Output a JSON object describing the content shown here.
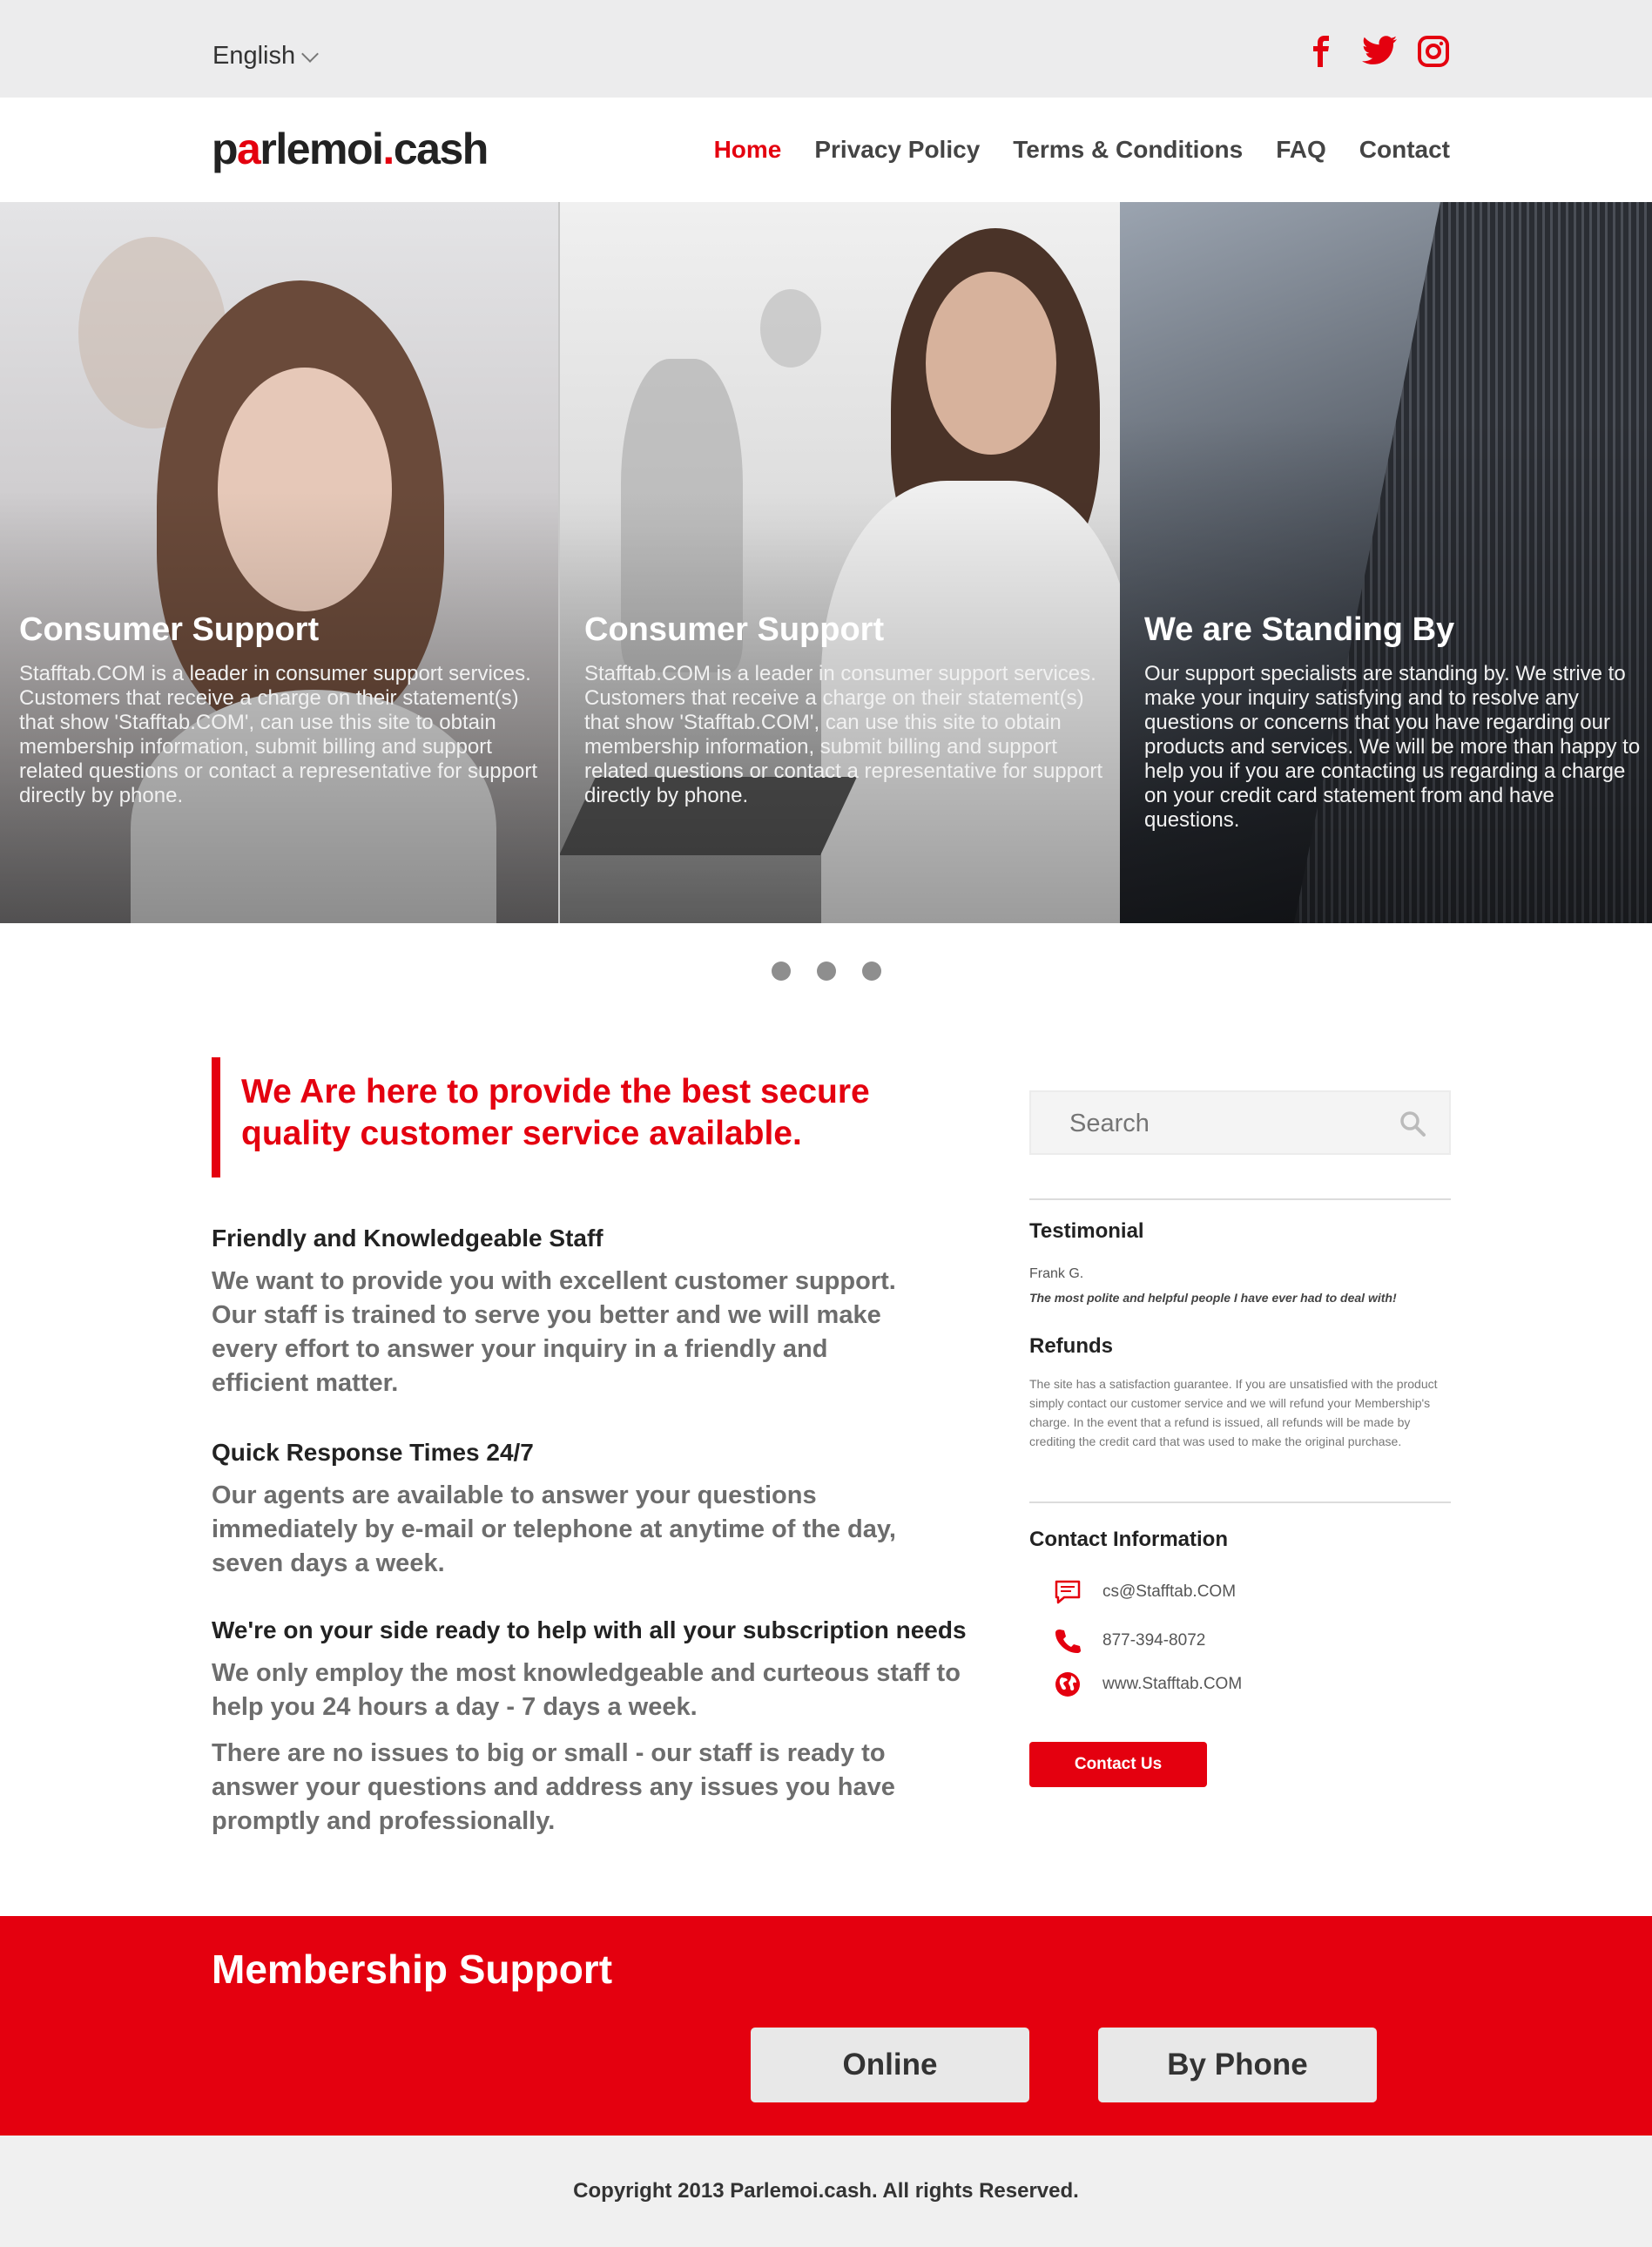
{
  "topbar": {
    "language": "English",
    "social": [
      "facebook-icon",
      "twitter-icon",
      "instagram-icon"
    ]
  },
  "header": {
    "logo_part1": "p",
    "logo_heart": "a",
    "logo_part2": "rlemoi",
    "logo_dot": ".",
    "logo_part3": "cash",
    "nav": [
      {
        "label": "Home",
        "active": true
      },
      {
        "label": "Privacy Policy",
        "active": false
      },
      {
        "label": "Terms & Conditions",
        "active": false
      },
      {
        "label": "FAQ",
        "active": false
      },
      {
        "label": "Contact",
        "active": false
      }
    ]
  },
  "hero": {
    "panels": [
      {
        "title": "Consumer Support",
        "text": "Stafftab.COM is a leader in consumer support services. Customers that receive a charge on their statement(s) that show 'Stafftab.COM', can use this site to obtain membership information, submit billing and support related questions or contact a representative for support directly by phone."
      },
      {
        "title": "Consumer Support",
        "text": "Stafftab.COM is a leader in consumer support services. Customers that receive a charge on their statement(s) that show 'Stafftab.COM', can use this site to obtain membership information, submit billing and support related questions or contact a representative for support directly by phone."
      },
      {
        "title": "We are Standing By",
        "text": "Our support specialists are standing by. We strive to make your inquiry satisfying and to resolve any questions or concerns that you have regarding our products and services. We will be more than happy to help you if you are contacting us regarding a charge on your credit card statement from and have questions."
      }
    ]
  },
  "main": {
    "quote": "We Are here to provide the best secure quality customer service available.",
    "sections": [
      {
        "heading": "Friendly and Knowledgeable Staff",
        "paragraphs": [
          "We want to provide you with excellent customer support. Our staff is trained to serve you better and we will make every effort to answer your inquiry in a friendly and efficient matter."
        ]
      },
      {
        "heading": "Quick Response Times 24/7",
        "paragraphs": [
          "Our agents are available to answer your questions immediately by e-mail or telephone at anytime of the day, seven days a week."
        ]
      },
      {
        "heading": "We're on your side ready to help with all your subscription needs",
        "paragraphs": [
          "We only employ the most knowledgeable and curteous staff to help you 24 hours a day - 7 days a week.",
          "There are no issues to big or small - our staff is ready to answer your questions and address any issues you have promptly and professionally."
        ]
      }
    ]
  },
  "sidebar": {
    "search_placeholder": "Search",
    "testimonial_heading": "Testimonial",
    "testimonial_author": "Frank G.",
    "testimonial_text": "The most polite and helpful people I have ever had to deal with!",
    "refunds_heading": "Refunds",
    "refunds_text": "The site has a satisfaction guarantee. If you are unsatisfied with the product simply contact our customer service and we will refund your Membership's charge. In the event that a refund is issued, all refunds will be made by crediting the credit card that was used to make the original purchase.",
    "contact_heading": "Contact Information",
    "email": "cs@Stafftab.COM",
    "phone": "877-394-8072",
    "website": "www.Stafftab.COM",
    "contact_button": "Contact Us"
  },
  "membership": {
    "title": "Membership Support",
    "online_button": "Online",
    "phone_button": "By Phone"
  },
  "footer": {
    "copyright": "Copyright 2013 Parlemoi.cash. All rights Reserved."
  },
  "colors": {
    "accent": "#e4000f",
    "topbar_bg": "#ececed",
    "footer_bg": "#f0f0f0"
  }
}
